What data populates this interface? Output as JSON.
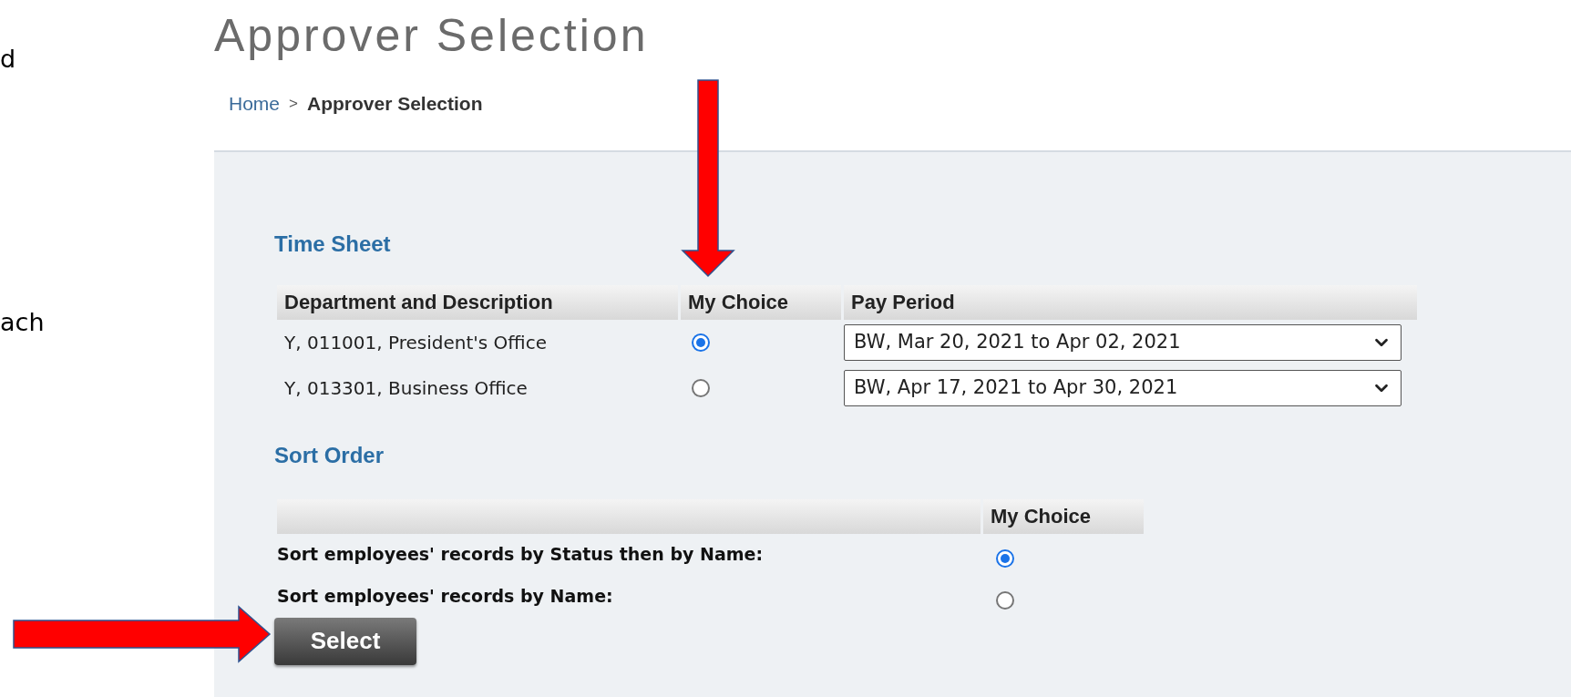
{
  "side_text": [
    "d",
    "ach"
  ],
  "page": {
    "title": "Approver Selection",
    "separator": ">",
    "breadcrumb": [
      {
        "label": "Home",
        "current": false
      },
      {
        "label": "Approver Selection",
        "current": true
      }
    ]
  },
  "time_sheet": {
    "heading": "Time Sheet",
    "columns": [
      "Department and Description",
      "My Choice",
      "Pay Period"
    ],
    "rows": [
      {
        "department": "Y, 011001, President's Office",
        "selected": true,
        "pay_period": "BW, Mar 20, 2021 to Apr 02, 2021"
      },
      {
        "department": "Y, 013301, Business Office",
        "selected": false,
        "pay_period": "BW, Apr 17, 2021 to Apr 30, 2021"
      }
    ]
  },
  "sort_order": {
    "heading": "Sort Order",
    "columns": [
      "My Choice"
    ],
    "options": [
      {
        "label": "Sort employees' records by Status then by Name:",
        "selected": true
      },
      {
        "label": "Sort employees' records by Name:",
        "selected": false
      }
    ]
  },
  "select_button": "Select"
}
